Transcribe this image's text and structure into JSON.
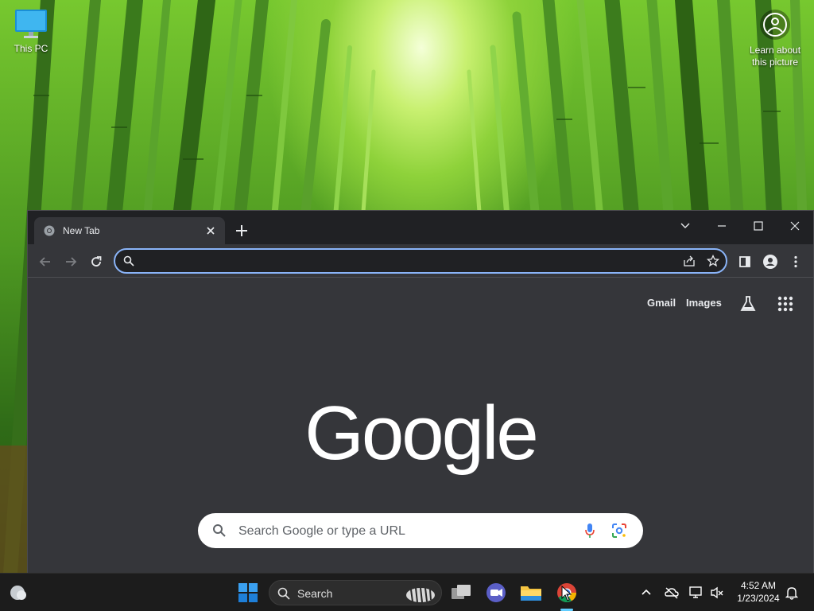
{
  "desktop": {
    "icons": [
      {
        "label": "This PC",
        "icon": "monitor-icon"
      }
    ],
    "spotlight": {
      "label_line1": "Learn about",
      "label_line2": "this picture",
      "icon": "camera-icon"
    }
  },
  "browser": {
    "tabs": [
      {
        "title": "New Tab",
        "favicon": "chrome-icon"
      }
    ],
    "omnibox": {
      "value": "",
      "placeholder": ""
    },
    "ntp": {
      "links": {
        "gmail": "Gmail",
        "images": "Images"
      },
      "logo": "Google",
      "search_placeholder": "Search Google or type a URL"
    }
  },
  "taskbar": {
    "search_label": "Search",
    "pinned": [
      "start-icon",
      "task-view-icon",
      "teams-meet-icon",
      "file-explorer-icon",
      "chrome-icon"
    ],
    "active_app": "chrome-icon",
    "clock": {
      "time": "4:52 AM",
      "date": "1/23/2024"
    }
  },
  "colors": {
    "chrome_dark": "#202124",
    "chrome_surface": "#35363a",
    "omnibox_focus": "#8ab4f8",
    "taskbar": "#1c1c1c",
    "accent": "#60cdff"
  }
}
